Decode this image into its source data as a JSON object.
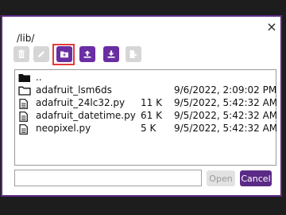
{
  "dialog": {
    "close_label": "×",
    "path": "/lib/"
  },
  "toolbar": {
    "buttons": [
      {
        "name": "trash-icon",
        "enabled": false
      },
      {
        "name": "pencil-icon",
        "enabled": false
      },
      {
        "name": "new-folder-icon",
        "enabled": true
      },
      {
        "name": "upload-icon",
        "enabled": true
      },
      {
        "name": "download-icon",
        "enabled": true
      },
      {
        "name": "move-file-icon",
        "enabled": false
      }
    ]
  },
  "files": [
    {
      "type": "folder",
      "name": "..",
      "size": "",
      "date": ""
    },
    {
      "type": "folder",
      "name": "adafruit_lsm6ds",
      "size": "",
      "date": "9/6/2022, 2:09:02 PM"
    },
    {
      "type": "file",
      "name": "adafruit_24lc32.py",
      "size": "11 K",
      "date": "9/5/2022, 5:42:32 AM"
    },
    {
      "type": "file",
      "name": "adafruit_datetime.py",
      "size": "61 K",
      "date": "9/5/2022, 5:42:32 AM"
    },
    {
      "type": "file",
      "name": "neopixel.py",
      "size": "5 K",
      "date": "9/5/2022, 5:42:32 AM"
    }
  ],
  "footer": {
    "filename_value": "",
    "open_label": "Open",
    "cancel_label": "Cancel"
  },
  "colors": {
    "accent": "#6a2ea3",
    "highlight": "#e23b3b",
    "disabled": "#d6d6d6"
  }
}
